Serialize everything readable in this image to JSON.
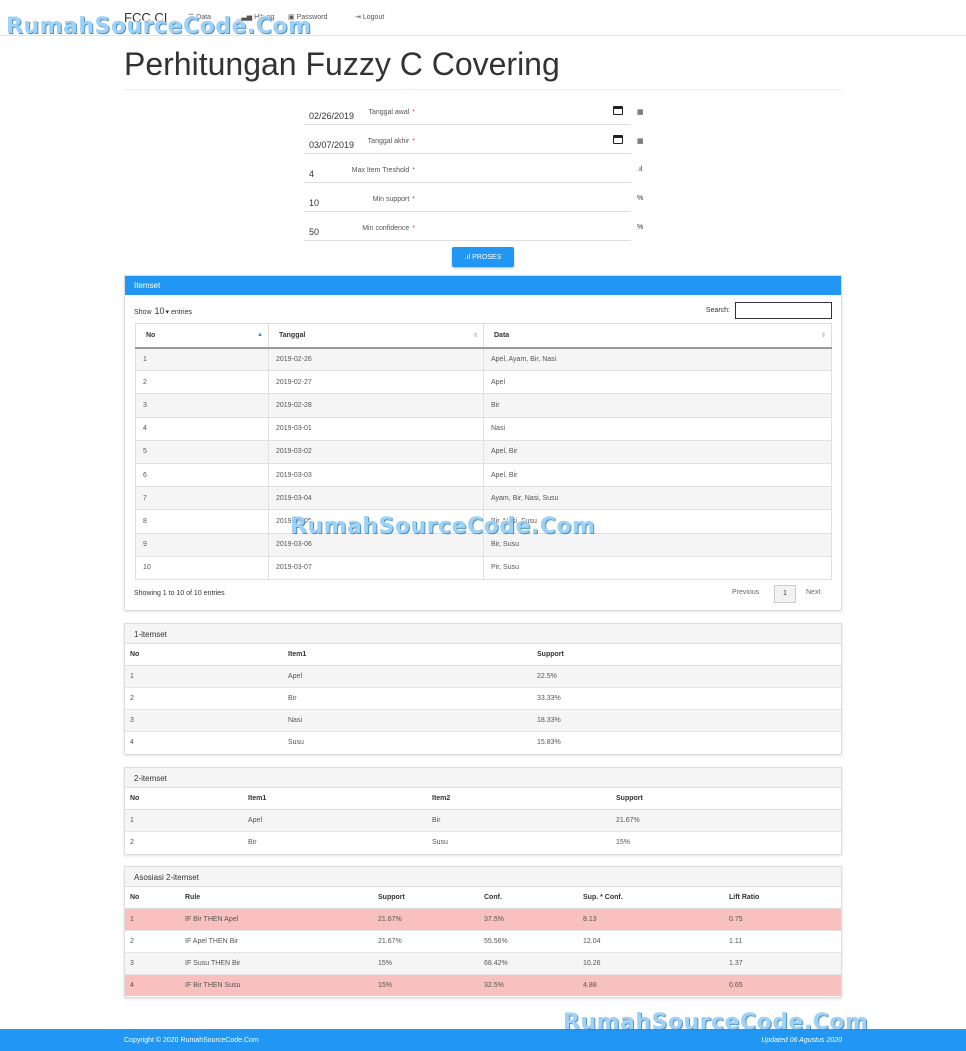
{
  "nav": {
    "brand": "FCC CI",
    "items": [
      {
        "label": "Data",
        "icon": "list-icon"
      },
      {
        "label": "Hitung",
        "icon": "signal-icon"
      },
      {
        "label": "Password",
        "icon": "lock-icon"
      },
      {
        "label": "Logout",
        "icon": "logout-icon"
      }
    ]
  },
  "watermark": "RumahSourceCode.Com",
  "page_title": "Perhitungan Fuzzy C Covering",
  "form": {
    "tanggal_awal": {
      "label": "Tanggal awal",
      "value": "02/26/2019",
      "required_mark": "*"
    },
    "tanggal_akhir": {
      "label": "Tanggal akhir",
      "value": "03/07/2019",
      "required_mark": "*"
    },
    "max_item": {
      "label": "Max Item Treshold",
      "value": "4",
      "required_mark": "*"
    },
    "min_support": {
      "label": "Min support",
      "value": "10",
      "addon": "%",
      "required_mark": "*"
    },
    "min_confidence": {
      "label": "Min confidence",
      "value": "50",
      "addon": "%",
      "required_mark": "*"
    },
    "submit_label": "PROSES"
  },
  "itemset": {
    "title": "Itemset",
    "show_prefix": "Show",
    "show_value": "10",
    "show_suffix": "entries",
    "search_label": "Search:",
    "search_value": "",
    "columns": [
      "No",
      "Tanggal",
      "Data"
    ],
    "rows": [
      [
        "1",
        "2019-02-26",
        "Apel, Ayam, Bir, Nasi"
      ],
      [
        "2",
        "2019-02-27",
        "Apel"
      ],
      [
        "3",
        "2019-02-28",
        "Bir"
      ],
      [
        "4",
        "2019-03-01",
        "Nasi"
      ],
      [
        "5",
        "2019-03-02",
        "Apel, Bir"
      ],
      [
        "6",
        "2019-03-03",
        "Apel, Bir"
      ],
      [
        "7",
        "2019-03-04",
        "Ayam, Bir, Nasi, Susu"
      ],
      [
        "8",
        "2019-03-05",
        "Bir, Nasi, Susu"
      ],
      [
        "9",
        "2019-03-06",
        "Bir, Susu"
      ],
      [
        "10",
        "2019-03-07",
        "Pir, Susu"
      ]
    ],
    "info": "Showing 1 to 10 of 10 entries",
    "prev": "Previous",
    "page": "1",
    "next": "Next"
  },
  "one_itemset": {
    "title": "1-itemset",
    "columns": [
      "No",
      "Item1",
      "Support"
    ],
    "rows": [
      [
        "1",
        "Apel",
        "22.5%"
      ],
      [
        "2",
        "Bir",
        "33.33%"
      ],
      [
        "3",
        "Nasi",
        "18.33%"
      ],
      [
        "4",
        "Susu",
        "15.83%"
      ]
    ]
  },
  "two_itemset": {
    "title": "2-itemset",
    "columns": [
      "No",
      "Item1",
      "Item2",
      "Support"
    ],
    "rows": [
      [
        "1",
        "Apel",
        "Bir",
        "21.67%"
      ],
      [
        "2",
        "Bir",
        "Susu",
        "15%"
      ]
    ]
  },
  "asosiasi": {
    "title": "Asosiasi 2-itemset",
    "columns": [
      "No",
      "Rule",
      "Support",
      "Conf.",
      "Sup. * Conf.",
      "Lift Ratio"
    ],
    "rows": [
      [
        "1",
        "IF Bir THEN Apel",
        "21.67%",
        "37.5%",
        "8.13",
        "0.75"
      ],
      [
        "2",
        "IF Apel THEN Bir",
        "21.67%",
        "55.56%",
        "12.04",
        "1.11"
      ],
      [
        "3",
        "IF Susu THEN Bir",
        "15%",
        "68.42%",
        "10.26",
        "1.37"
      ],
      [
        "4",
        "IF Bir THEN Susu",
        "15%",
        "32.5%",
        "4.88",
        "0.65"
      ]
    ],
    "highlight_rows": [
      1,
      4
    ],
    "highlight_color": "#f8c0bf"
  },
  "footer": {
    "copyright": "Copyright © 2020 RumahSourceCode.Com",
    "updated": "Updated 06 Agustus 2020"
  },
  "colors": {
    "primary": "#2196f3",
    "required": "#e53935"
  }
}
